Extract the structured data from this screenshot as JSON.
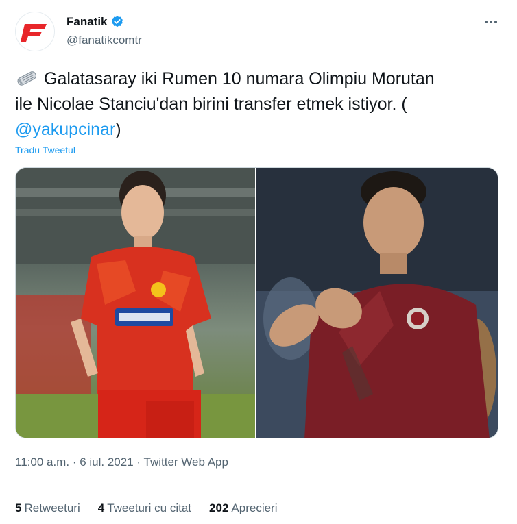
{
  "author": {
    "name": "Fanatik",
    "handle": "@fanatikcomtr",
    "verified": true
  },
  "tweet": {
    "line1": "Galatasaray iki Rumen 10 numara Olimpiu Morutan",
    "line2": "ile Nicolae Stanciu'dan birini transfer etmek istiyor. (",
    "mention": "@yakupcinar",
    "line3_end": ")",
    "translate_label": "Tradu Tweetul",
    "emoji_icon": "newspaper-icon"
  },
  "media": {
    "photos": [
      {
        "name": "photo-player-left"
      },
      {
        "name": "photo-player-right"
      }
    ]
  },
  "meta": {
    "time": "11:00 a.m.",
    "separator": "·",
    "date": "6 iul. 2021",
    "app": "Twitter Web App"
  },
  "stats": {
    "retweets_count": "5",
    "retweets_label": "Retweeturi",
    "quotes_count": "4",
    "quotes_label": "Tweeturi cu citat",
    "likes_count": "202",
    "likes_label": "Aprecieri"
  },
  "colors": {
    "accent": "#1d9bf0",
    "brand": "#e8262a",
    "text": "#0f1419",
    "secondary": "#536471"
  }
}
